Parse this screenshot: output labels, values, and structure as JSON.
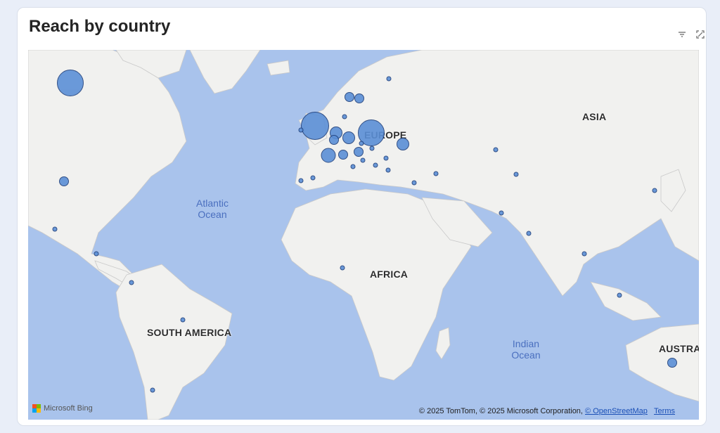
{
  "visual": {
    "title": "Reach by country",
    "icons": [
      "filter-icon",
      "focus-mode-icon"
    ]
  },
  "map": {
    "ocean_labels": {
      "atlantic": [
        "Atlantic",
        "Ocean"
      ],
      "indian": [
        "Indian",
        "Ocean"
      ]
    },
    "continent_labels": {
      "europe": "EUROPE",
      "asia": "ASIA",
      "africa": "AFRICA",
      "south_america": "SOUTH AMERICA",
      "australia": "AUSTRA"
    },
    "attribution": {
      "text": "© 2025 TomTom, © 2025 Microsoft Corporation, ",
      "osm_link": "© OpenStreetMap",
      "terms_link": "Terms"
    },
    "brand": "Microsoft Bing",
    "colors": {
      "bubble_fill": "#5b8fd6",
      "bubble_stroke": "#1f3f7a",
      "water": "#a9c3ec",
      "land": "#f1f1ef"
    },
    "bubbles": [
      {
        "region": "Canada (north)",
        "size": "xl"
      },
      {
        "region": "USA",
        "size": "sm"
      },
      {
        "region": "Mexico",
        "size": "xs"
      },
      {
        "region": "Central America",
        "size": "xs"
      },
      {
        "region": "Colombia",
        "size": "xs"
      },
      {
        "region": "Brazil",
        "size": "xs"
      },
      {
        "region": "Argentina",
        "size": "xs"
      },
      {
        "region": "United Kingdom",
        "size": "xxl"
      },
      {
        "region": "Ireland",
        "size": "xs"
      },
      {
        "region": "Norway",
        "size": "sm"
      },
      {
        "region": "Sweden",
        "size": "sm"
      },
      {
        "region": "Finland",
        "size": "xs"
      },
      {
        "region": "Denmark",
        "size": "xs"
      },
      {
        "region": "Netherlands",
        "size": "md"
      },
      {
        "region": "Belgium",
        "size": "sm"
      },
      {
        "region": "Germany",
        "size": "md"
      },
      {
        "region": "Poland",
        "size": "xl"
      },
      {
        "region": "Ukraine",
        "size": "md"
      },
      {
        "region": "France",
        "size": "lg"
      },
      {
        "region": "Switzerland",
        "size": "sm"
      },
      {
        "region": "Austria",
        "size": "sm"
      },
      {
        "region": "Czechia",
        "size": "xs"
      },
      {
        "region": "Hungary",
        "size": "xs"
      },
      {
        "region": "Slovenia",
        "size": "xs"
      },
      {
        "region": "Italy",
        "size": "xs"
      },
      {
        "region": "Serbia",
        "size": "xs"
      },
      {
        "region": "Romania",
        "size": "xs"
      },
      {
        "region": "Bulgaria",
        "size": "xs"
      },
      {
        "region": "Spain",
        "size": "xs"
      },
      {
        "region": "Portugal",
        "size": "xs"
      },
      {
        "region": "Georgia",
        "size": "xs"
      },
      {
        "region": "Turkey",
        "size": "xs"
      },
      {
        "region": "Kazakhstan",
        "size": "xs"
      },
      {
        "region": "Kyrgyzstan",
        "size": "xs"
      },
      {
        "region": "Pakistan",
        "size": "xs"
      },
      {
        "region": "India",
        "size": "xs"
      },
      {
        "region": "Thailand",
        "size": "xs"
      },
      {
        "region": "Borneo",
        "size": "xs"
      },
      {
        "region": "South Korea",
        "size": "xs"
      },
      {
        "region": "Nigeria",
        "size": "xs"
      },
      {
        "region": "Australia",
        "size": "sm"
      }
    ]
  }
}
